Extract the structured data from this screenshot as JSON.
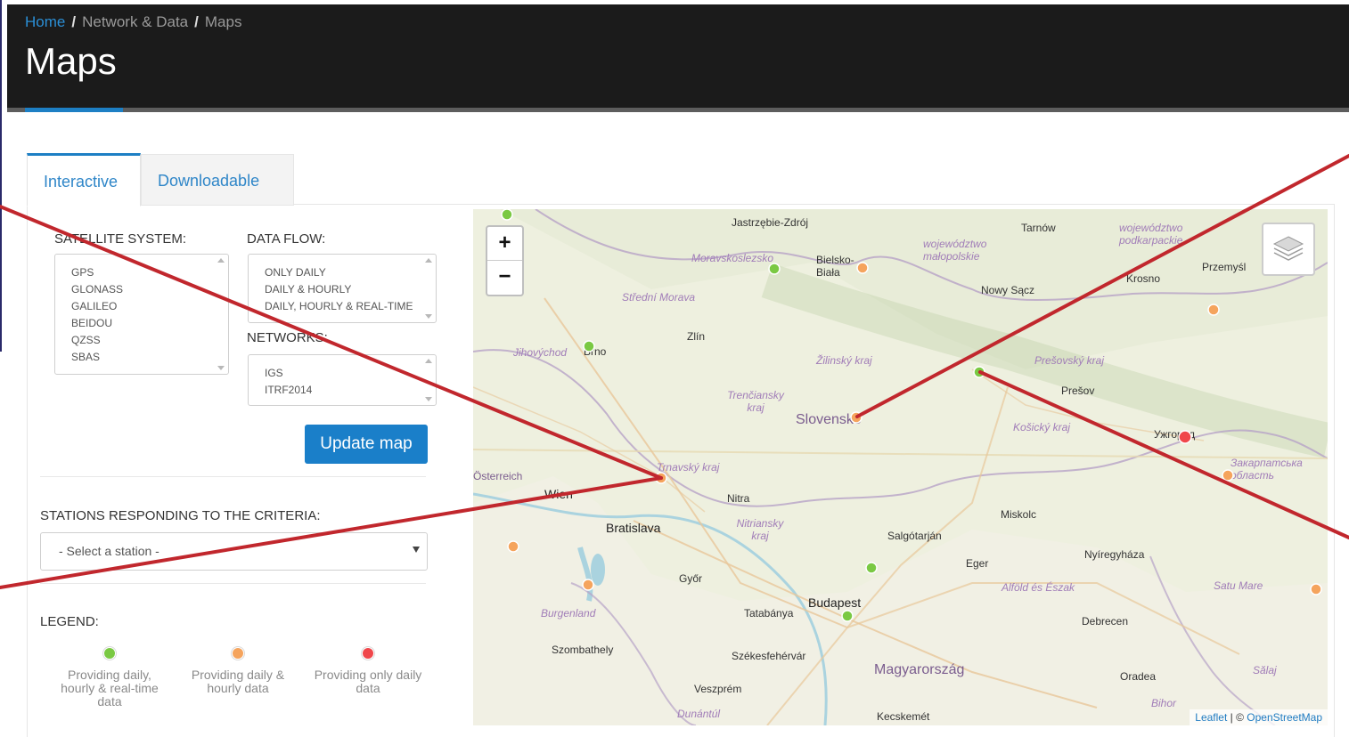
{
  "breadcrumb": {
    "home": "Home",
    "section": "Network & Data",
    "current": "Maps",
    "separator": "/"
  },
  "page_title": "Maps",
  "tabs": [
    {
      "label": "Interactive",
      "active": true
    },
    {
      "label": "Downloadable",
      "active": false
    }
  ],
  "filters": {
    "satellite_label": "SATELLITE SYSTEM:",
    "satellite_options": [
      "GPS",
      "GLONASS",
      "GALILEO",
      "BEIDOU",
      "QZSS",
      "SBAS"
    ],
    "dataflow_label": "DATA FLOW:",
    "dataflow_options": [
      "ONLY DAILY",
      "DAILY & HOURLY",
      "DAILY, HOURLY & REAL-TIME"
    ],
    "networks_label": "NETWORKS:",
    "networks_options": [
      "IGS",
      "ITRF2014"
    ],
    "update_button": "Update map"
  },
  "stations": {
    "label": "STATIONS RESPONDING TO THE CRITERIA:",
    "placeholder": "- Select a station -"
  },
  "legend": {
    "title": "LEGEND:",
    "items": [
      {
        "text": "Providing daily, hourly & real-time data",
        "color": "#7ac943"
      },
      {
        "text": "Providing daily & hourly data",
        "color": "#f5a45d"
      },
      {
        "text": "Providing only daily data",
        "color": "#f0474b"
      }
    ]
  },
  "map": {
    "zoom_in": "+",
    "zoom_out": "−",
    "layers_icon": "layers-icon",
    "attribution_leaflet": "Leaflet",
    "attribution_sep": " | © ",
    "attribution_osm": "OpenStreetMap",
    "labels": {
      "jastrzebie": "Jastrzębie-Zdrój",
      "tarnow": "Tarnów",
      "woj_podkarpackie": "województwo podkarpackie",
      "woj_malopolskie": "województwo małopolskie",
      "bielsko": "Bielsko-Biała",
      "moravskoslezsko": "Moravskoslezsko",
      "przemysl": "Przemyśl",
      "krosno": "Krosno",
      "nowy_sacz": "Nowy Sącz",
      "stredni_morava": "Střední Morava",
      "zlin": "Zlín",
      "jihovychod": "Jihovýchod",
      "brno": "Brno",
      "zilinsky": "Žilinský kraj",
      "presovsky": "Prešovský kraj",
      "presov": "Prešov",
      "trenciansky": "Trenčiansky kraj",
      "slovensko": "Slovensko",
      "kosicky": "Košický kraj",
      "uzhgorod": "Ужгород",
      "zakarpatska": "Закарпатська область",
      "osterreich": "Österreich",
      "trnavsky": "Trnavský kraj",
      "wien": "Wien",
      "nitra": "Nitra",
      "bratislava": "Bratislava",
      "nitriansky": "Nitriansky kraj",
      "miskolc": "Miskolc",
      "salgotarjan": "Salgótarján",
      "eger": "Eger",
      "nyiregyhaza": "Nyíregyháza",
      "gyor": "Győr",
      "alfold": "Alföld és Észak",
      "satu_mare": "Satu Mare",
      "burgenland": "Burgenland",
      "tatabanya": "Tatabánya",
      "budapest": "Budapest",
      "debrecen": "Debrecen",
      "szombathely": "Szombathely",
      "szekesfehervar": "Székesfehérvár",
      "magyarorszag": "Magyarország",
      "salaj": "Sălaj",
      "oradea": "Oradea",
      "veszprem": "Veszprém",
      "dunantul": "Dunántúl",
      "bihor": "Bihor",
      "kecskemet": "Kecskemét"
    },
    "markers": [
      {
        "id": "station-marker-1",
        "status": "daily-hourly-realtime",
        "color": "#7ac943"
      },
      {
        "id": "station-marker-2",
        "status": "daily-hourly-realtime",
        "color": "#7ac943"
      },
      {
        "id": "station-marker-3",
        "status": "daily-hourly-realtime",
        "color": "#7ac943"
      },
      {
        "id": "station-marker-4",
        "status": "daily-hourly-realtime",
        "color": "#7ac943"
      },
      {
        "id": "station-marker-5",
        "status": "daily-hourly-realtime",
        "color": "#7ac943"
      },
      {
        "id": "station-marker-6",
        "status": "daily-hourly",
        "color": "#f5a45d"
      },
      {
        "id": "station-marker-7",
        "status": "daily-hourly",
        "color": "#f5a45d"
      },
      {
        "id": "station-marker-8",
        "status": "daily-hourly",
        "color": "#f5a45d"
      },
      {
        "id": "station-marker-9",
        "status": "daily-hourly",
        "color": "#f5a45d"
      },
      {
        "id": "station-marker-10",
        "status": "daily-hourly",
        "color": "#f5a45d"
      },
      {
        "id": "station-marker-11",
        "status": "only-daily",
        "color": "#f0474b"
      }
    ]
  },
  "annotation_color": "#c1272d"
}
